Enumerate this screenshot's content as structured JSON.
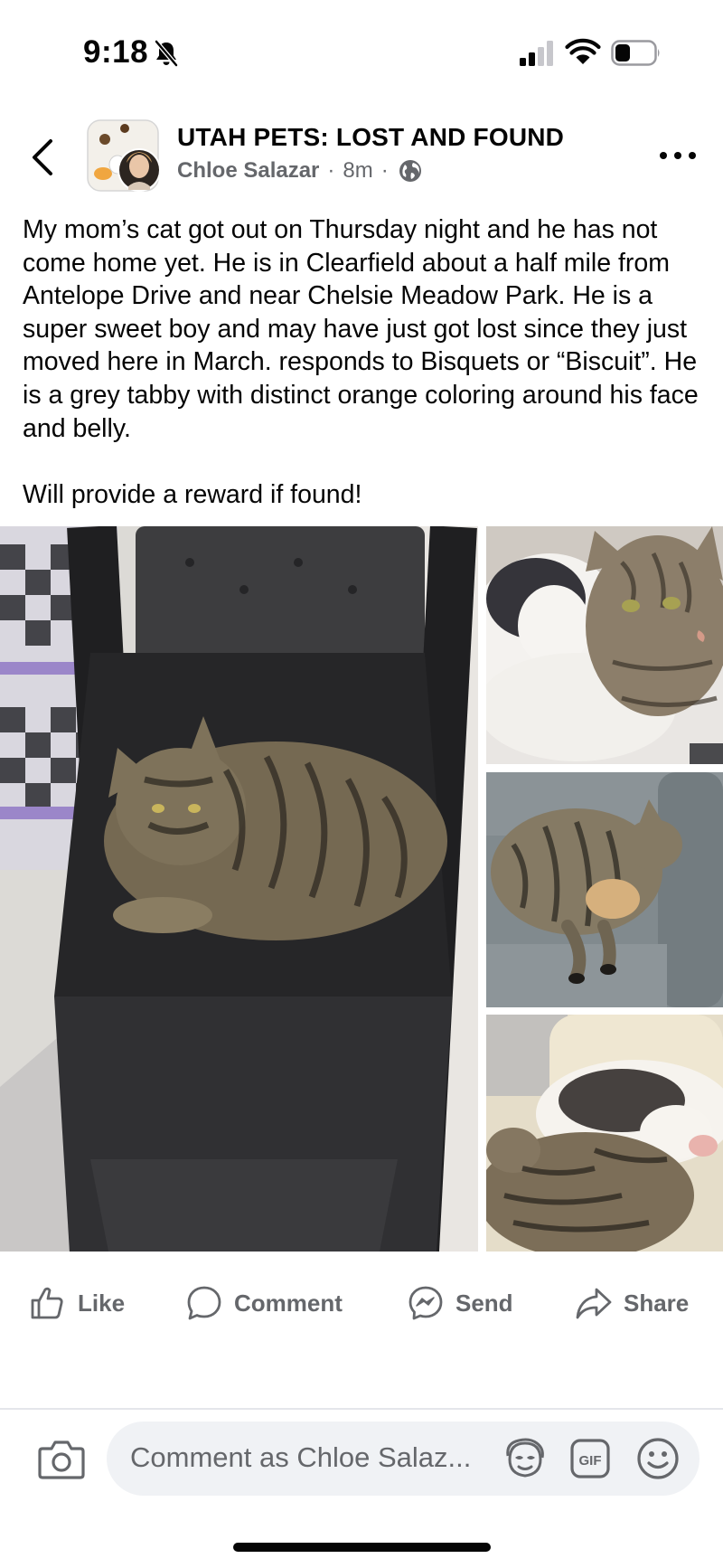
{
  "status_bar": {
    "time": "9:18",
    "icons": [
      "bell-slash-icon",
      "cellular-signal-icon",
      "wifi-icon",
      "battery-icon"
    ]
  },
  "header": {
    "back_icon": "chevron-left-icon",
    "group_name": "UTAH PETS: LOST AND FOUND",
    "author": "Chloe Salazar",
    "separator": "·",
    "time_ago": "8m",
    "audience_icon": "globe-icon",
    "more_icon": "more-horizontal-icon"
  },
  "post": {
    "paragraph_1": "My mom’s cat got out on Thursday night and he has not come home yet. He is in Clearfield about a half mile from Antelope Drive and near Chelsie Meadow Park. He is a super sweet boy and may have just got lost since they just moved here in March. responds to Bisquets or “Biscuit”. He is a grey tabby with distinct orange coloring around his face and belly.",
    "paragraph_2": "Will provide a reward if found!"
  },
  "photos": [
    "tabby-cat-on-black-chair",
    "tabby-and-white-cat-cuddling",
    "tabby-cat-sleeping-on-grey-sofa",
    "two-cats-curled-on-cushion"
  ],
  "actions": {
    "like": "Like",
    "comment": "Comment",
    "send": "Send",
    "share": "Share"
  },
  "comment_bar": {
    "placeholder": "Comment as Chloe Salaz...",
    "icons": [
      "camera-icon",
      "avatar-sticker-icon",
      "gif-icon",
      "emoji-icon"
    ]
  },
  "colors": {
    "text_primary": "#050505",
    "text_secondary": "#65676b",
    "input_background": "#f0f2f5",
    "divider": "#e4e6eb"
  }
}
